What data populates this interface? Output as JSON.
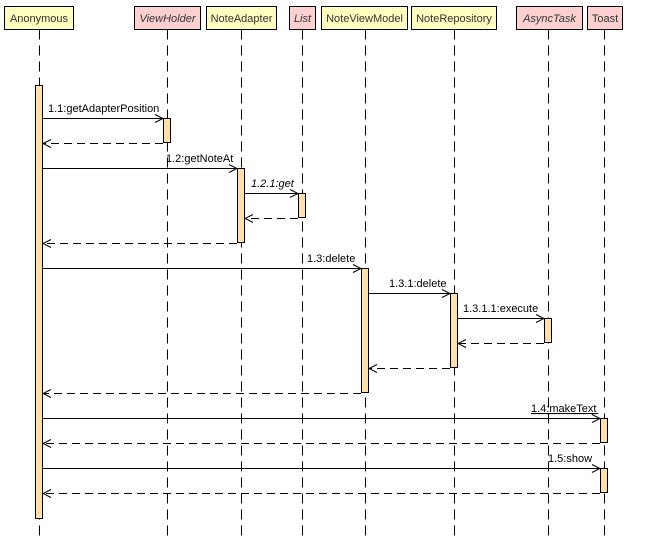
{
  "diagram": {
    "type": "sequence",
    "colors": {
      "class_fill": "#ffffc0",
      "interface_fill": "#ffd0d0",
      "activation_fill": "#ffe0a8",
      "line": "#000000"
    },
    "lifelines": [
      {
        "id": "anonymous",
        "label": "Anonymous",
        "italic": false,
        "kind": "class"
      },
      {
        "id": "viewholder",
        "label": "ViewHolder",
        "italic": true,
        "kind": "interface"
      },
      {
        "id": "noteadapter",
        "label": "NoteAdapter",
        "italic": false,
        "kind": "class"
      },
      {
        "id": "list",
        "label": "List",
        "italic": true,
        "kind": "interface"
      },
      {
        "id": "noteviewmodel",
        "label": "NoteViewModel",
        "italic": false,
        "kind": "class"
      },
      {
        "id": "noterepository",
        "label": "NoteRepository",
        "italic": false,
        "kind": "class"
      },
      {
        "id": "asynctask",
        "label": "AsyncTask",
        "italic": true,
        "kind": "interface"
      },
      {
        "id": "toast",
        "label": "Toast",
        "italic": false,
        "kind": "interface"
      }
    ],
    "messages": [
      {
        "label": "1.1:getAdapterPosition",
        "from": "anonymous",
        "to": "viewholder",
        "italic": false,
        "underline": false
      },
      {
        "label": "1.2:getNoteAt",
        "from": "anonymous",
        "to": "noteadapter",
        "italic": false,
        "underline": false
      },
      {
        "label": "1.2.1:get",
        "from": "noteadapter",
        "to": "list",
        "italic": true,
        "underline": false
      },
      {
        "label": "1.3:delete",
        "from": "anonymous",
        "to": "noteviewmodel",
        "italic": false,
        "underline": false
      },
      {
        "label": "1.3.1:delete",
        "from": "noteviewmodel",
        "to": "noterepository",
        "italic": false,
        "underline": false
      },
      {
        "label": "1.3.1.1:execute",
        "from": "noterepository",
        "to": "asynctask",
        "italic": false,
        "underline": false
      },
      {
        "label": "1.4:makeText",
        "from": "anonymous",
        "to": "toast",
        "italic": false,
        "underline": true
      },
      {
        "label": "1.5:show",
        "from": "anonymous",
        "to": "toast",
        "italic": false,
        "underline": false
      }
    ]
  }
}
